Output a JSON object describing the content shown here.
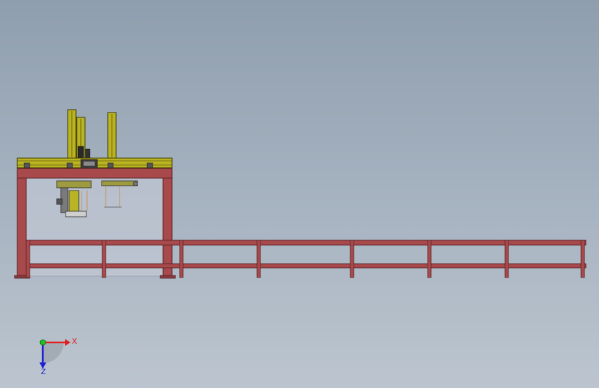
{
  "viewport": {
    "background_top": "#8f9eae",
    "background_bottom": "#bcc5cf"
  },
  "model": {
    "frame_color": "#a8494c",
    "frame_outline": "#5a2426",
    "gantry_color": "#b8b022",
    "gantry_outline": "#4a4608",
    "enclosure_color": "#c8ccd6",
    "column_count": 3,
    "conveyor_leg_count": 6
  },
  "triad": {
    "x_label": "X",
    "z_label": "Z",
    "x_color": "#e02020",
    "y_color": "#20c020",
    "z_color": "#2020d0"
  }
}
